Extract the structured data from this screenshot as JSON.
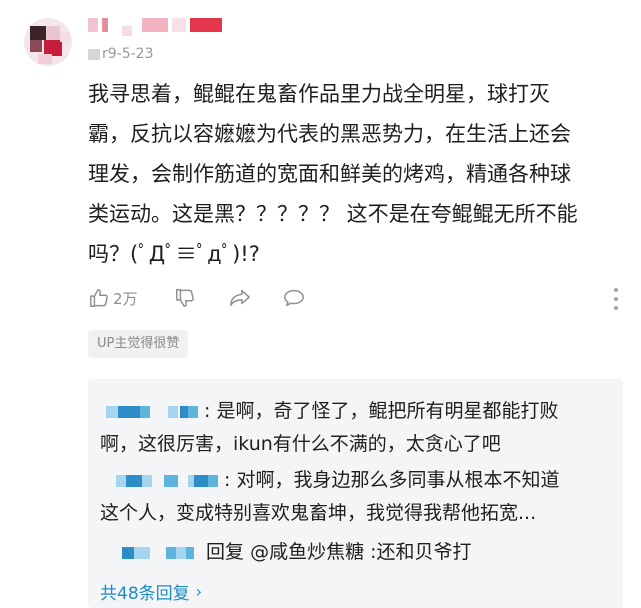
{
  "comment": {
    "username": "",
    "date": "r9-5-23",
    "text_lines": [
      "我寻思着，鲲鲲在鬼畜作品里力战全明星，球打灭",
      "霸，反抗以容嬷嬷为代表的黑恶势力，在生活上还会",
      "理发，会制作筋道的宽面和鲜美的烤鸡，精通各种球",
      "类运动。这是黑？？？？？ 这不是在夸鲲鲲无所不能",
      "吗？(ﾟДﾟ≡ﾟдﾟ)!?"
    ],
    "like_count": "2万",
    "up_badge": "UP主觉得很赞"
  },
  "icons": {
    "like": "thumbs-up-icon",
    "dislike": "thumbs-down-icon",
    "share": "share-icon",
    "reply": "comment-bubble-icon",
    "more": "more-vertical-icon"
  },
  "replies": [
    {
      "lines": [
        ": 是啊，奇了怪了，鲲把所有明星都能打败",
        "啊，这很厉害，ikun有什么不满的，太贪心了吧"
      ]
    },
    {
      "lines": [
        ": 对啊，我身边那么多同事从根本不知道",
        "这个人，变成特别喜欢鬼畜坤，我觉得我帮他拓宽..."
      ]
    },
    {
      "lines": [
        "回复 @咸鱼炒焦糖 :还和贝爷打"
      ]
    }
  ],
  "more_replies_label": "共48条回复",
  "colors": {
    "link": "#1e8bc6",
    "reply_bg": "#f4f5f6",
    "muted": "#9a9a9a"
  }
}
